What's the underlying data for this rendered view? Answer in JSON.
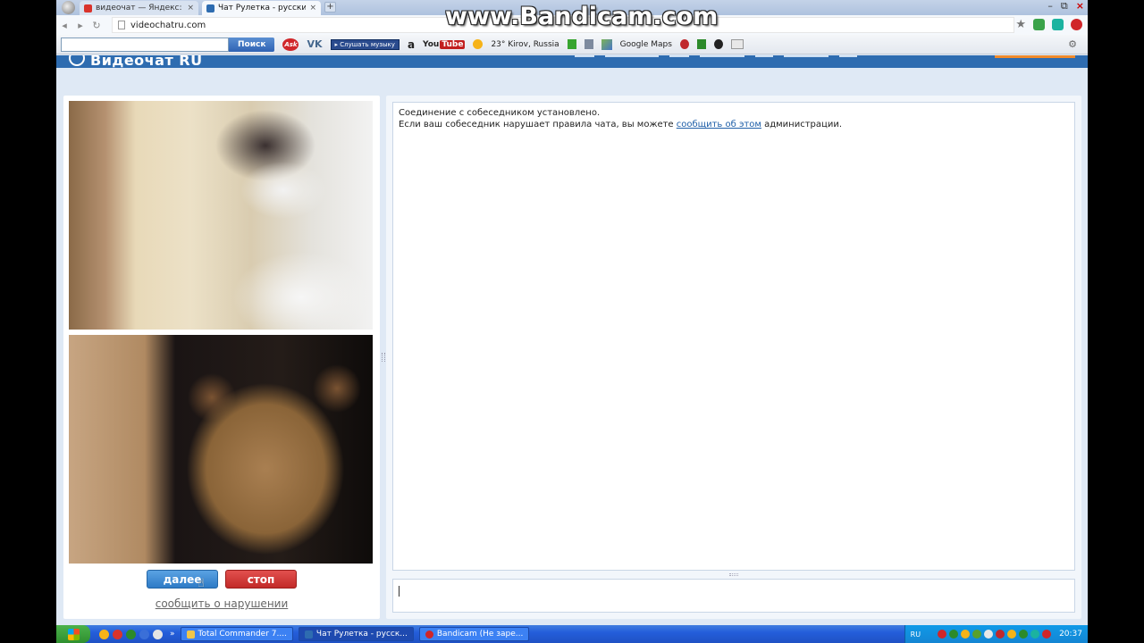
{
  "watermark": "www.Bandicam.com",
  "tabs": [
    {
      "title": "видеочат — Яндекс: нашлос",
      "close": "×"
    },
    {
      "title": "Чат Рулетка - русский видео",
      "close": "×"
    }
  ],
  "newtab": "+",
  "window_controls": {
    "minimize": "–",
    "restore": "⧉",
    "close": "×"
  },
  "nav": {
    "back": "◂",
    "forward": "▸",
    "reload": "↻"
  },
  "address_bar": {
    "url": "videochatru.com"
  },
  "bookmark_star": "★",
  "yandex_bar": {
    "search_button": "Поиск",
    "ask_label": "Ask",
    "vk_label": "VK",
    "music_label": "▸ Слушать музыку",
    "amazon_label": "a",
    "youtube_label_a": "You",
    "youtube_label_b": "Tube",
    "weather": "23° Kirov, Russia",
    "maps": "Google Maps",
    "dropdown": "▾",
    "settings": "⚙"
  },
  "site": {
    "logo": "Видеочат RU"
  },
  "video": {
    "next_button": "далее",
    "stop_button": "стоп",
    "report_link": "сообщить о нарушении"
  },
  "chat": {
    "line1": "Соединение с собеседником установлено.",
    "line2_before": "Если ваш собеседник нарушает правила чата, вы можете ",
    "line2_link": "сообщить об этом",
    "line2_after": " администрации."
  },
  "taskbar": {
    "tasks": [
      {
        "label": "Total Commander 7...."
      },
      {
        "label": "Чат Рулетка - русск..."
      },
      {
        "label": "Bandicam (Не заре..."
      }
    ],
    "chevron": "»",
    "lang": "RU",
    "clock": "20:37"
  }
}
